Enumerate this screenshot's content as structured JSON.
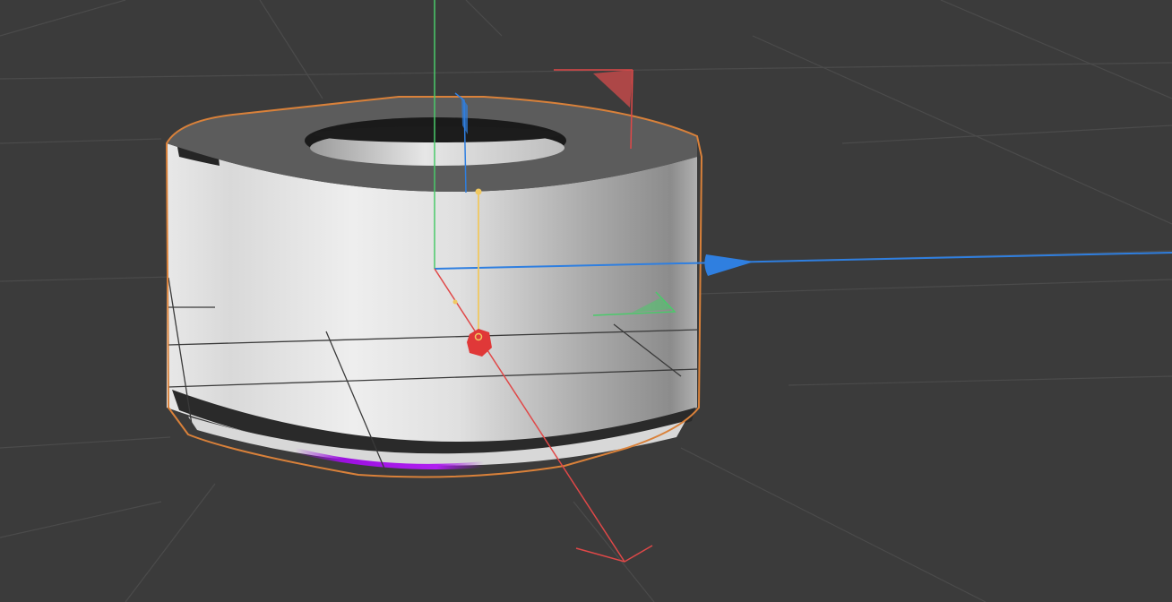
{
  "viewport": {
    "background_color": "#3b3b3b",
    "grid_color": "#4a4a4a",
    "selection_outline_color": "#d9813a"
  },
  "gizmo": {
    "x_axis_color": "#e04848",
    "y_axis_color": "#4aca6a",
    "z_axis_color": "#2f7fe0",
    "pivot_line_color": "#f0c860",
    "z_handle_icon": "arrow-cone-icon",
    "x_handle_icon": "plane-flag-icon",
    "y_handle_icon": "plane-flag-icon",
    "pivot_icon": "hexagon-handle-icon"
  },
  "object": {
    "type": "cylinder-tube",
    "shading_light": "#e6e6e6",
    "shading_dark": "#7a7a7a",
    "top_face_color": "#5c5c5c",
    "rim_highlight_color": "#9b10e0"
  }
}
